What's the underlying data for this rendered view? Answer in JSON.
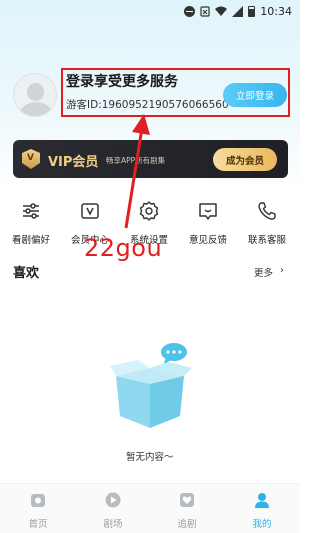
{
  "status_bar": {
    "time": "10:34"
  },
  "profile": {
    "login_title": "登录享受更多服务",
    "guest_id": "游客ID:1960952190576066560",
    "login_button": "立即登录"
  },
  "vip": {
    "badge": "V",
    "title": "VIP会员",
    "subtitle": "畅享APP所有剧集",
    "button": "成为会员"
  },
  "shortcuts": [
    {
      "label": "看剧偏好",
      "icon": "sliders-icon"
    },
    {
      "label": "会员中心",
      "icon": "vip-card-icon"
    },
    {
      "label": "系统设置",
      "icon": "gear-icon"
    },
    {
      "label": "意见反馈",
      "icon": "feedback-icon"
    },
    {
      "label": "联系客服",
      "icon": "phone-icon"
    }
  ],
  "watermark": "22gou",
  "favorites": {
    "title": "喜欢",
    "more": "更多",
    "empty_text": "暂无内容～"
  },
  "bottom_nav": [
    {
      "label": "首页",
      "icon": "home-icon",
      "active": false
    },
    {
      "label": "剧场",
      "icon": "play-icon",
      "active": false
    },
    {
      "label": "追剧",
      "icon": "heart-icon",
      "active": false
    },
    {
      "label": "我的",
      "icon": "profile-icon",
      "active": true
    }
  ],
  "colors": {
    "accent": "#2cb3ea",
    "highlight_box": "#e02020",
    "vip_gold": "#f1cf83"
  }
}
